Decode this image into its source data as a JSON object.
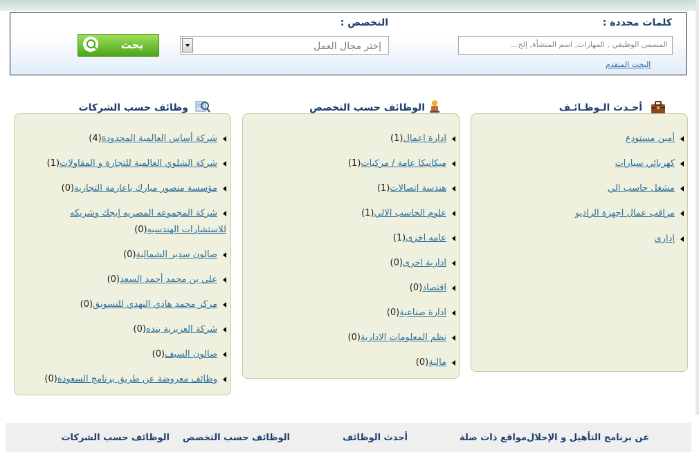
{
  "search": {
    "keywords_label": "كلمات محددة :",
    "keywords_placeholder": "المسمى الوظيفي , المهارات, اسم المنشأة, إلخ...",
    "specialty_label": "التخصص :",
    "specialty_selected": "إختر مجال العمل",
    "search_button": "بحث",
    "advanced_link": "البحث المتقدم"
  },
  "sections": {
    "latest": {
      "title": "أحـدث الـوظـائـف",
      "icon": "briefcase-icon",
      "items": [
        {
          "text": "أمين مستودع",
          "count": ""
        },
        {
          "text": "كهربائي سيارات",
          "count": ""
        },
        {
          "text": "مشغل حاسب الي",
          "count": ""
        },
        {
          "text": "مراقب عمال اجهزة الراديو",
          "count": ""
        },
        {
          "text": "إداري",
          "count": ""
        }
      ]
    },
    "by_specialty": {
      "title": "الوظائف حسب التخصص",
      "icon": "worker-icon",
      "items": [
        {
          "text": "ادارة اعمال",
          "count": "(1)"
        },
        {
          "text": "ميكانيكا عامة / مركبات",
          "count": "(1)"
        },
        {
          "text": "هندسة اتصالات",
          "count": "(1)"
        },
        {
          "text": "علوم الحاسب الالي",
          "count": "(1)"
        },
        {
          "text": "عامه اخرى",
          "count": "(1)"
        },
        {
          "text": "ادارية اخرى",
          "count": "(0)"
        },
        {
          "text": "اقتصاد",
          "count": "(0)"
        },
        {
          "text": "ادارة صناعية",
          "count": "(0)"
        },
        {
          "text": "نظم المعلومات الادارية",
          "count": "(0)"
        },
        {
          "text": "مالية",
          "count": "(0)"
        }
      ]
    },
    "by_company": {
      "title": "وظائف حسب الشركات",
      "icon": "company-search-icon",
      "items": [
        {
          "text": "شركة أساس العالمية المحدودة",
          "count": "(4)"
        },
        {
          "text": "شركة الشلوي العالمية للتجارة و المقاولات",
          "count": "(1)"
        },
        {
          "text": "مؤسسة منصور مبارك باعارمة التجارية",
          "count": "(0)"
        },
        {
          "text": "شركة المجموعه المصريه إيجك وشريكه",
          "text2": "للاستشارات الهندسيه",
          "count": "(0)"
        },
        {
          "text": "صالون سدير الشمالية",
          "count": "(0)"
        },
        {
          "text": "علي بن محمد أحمد السعد",
          "count": "(0)"
        },
        {
          "text": "مركز محمد هادي النهدي للتسويق",
          "count": "(0)"
        },
        {
          "text": "شركة العزيزية بنده",
          "count": "(0)"
        },
        {
          "text": "صالون السيف",
          "count": "(0)"
        },
        {
          "text": "وظائف معروضة عن طريق برنامج السعودة",
          "count": "(0)"
        }
      ]
    }
  },
  "footer": {
    "links": [
      "عن برنامج التأهيل و الإحلال",
      "مواقع ذات صلة",
      "أحدث الوظائف",
      "الوظائف حسب التخصص",
      "الوظائف حسب الشركات"
    ]
  },
  "colors": {
    "heading": "#1d3f6e",
    "link": "#2a6f9b",
    "panel": "#f0f0de",
    "button": "#5cb524"
  }
}
